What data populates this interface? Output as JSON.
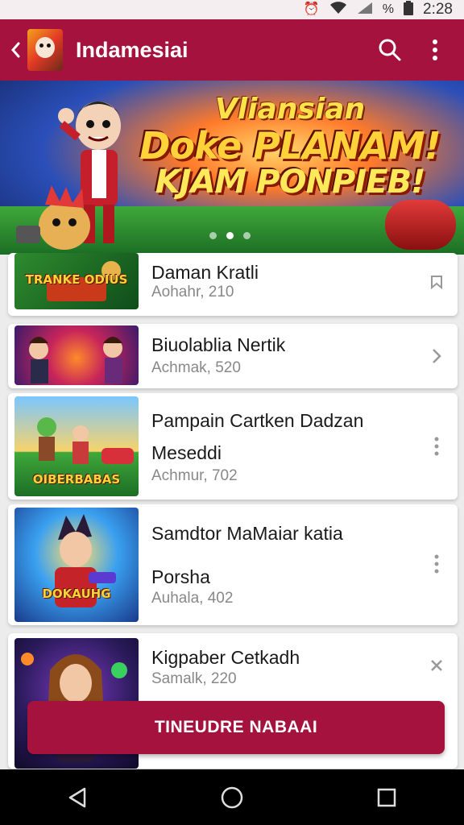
{
  "status_bar": {
    "time": "2:28",
    "icons": [
      "alarm-icon",
      "wifi-icon",
      "signal-icon",
      "battery-icon"
    ],
    "battery_label": "%"
  },
  "app_bar": {
    "title": "Indamesiai",
    "background": "#a5123e",
    "actions": [
      "back-icon",
      "search-icon",
      "more-vert-icon"
    ]
  },
  "banner": {
    "line1": "Vliansian",
    "line2": "Doke PLANAM!",
    "line3": "KJAM PONPIEB!",
    "page_count": 3,
    "active_page": 1
  },
  "games": [
    {
      "title": "Daman Kratli",
      "title2": "",
      "subtitle": "Aohahr, 210",
      "thumb_label": "TRANKE ODIUS",
      "action": "bookmark-icon"
    },
    {
      "title": "Biuolablia Nertik",
      "title2": "",
      "subtitle": "Achmak, 520",
      "thumb_label": "",
      "action": "chevron-right-icon"
    },
    {
      "title": "Pampain Cartken Dadzan",
      "title2": "Meseddi",
      "subtitle": "Achmur, 702",
      "thumb_label": "OIBERBABAS",
      "action": "more-vert-icon"
    },
    {
      "title": "Samdtor MaMaiar katia",
      "title2": "Porsha",
      "subtitle": "Auhala, 402",
      "thumb_label": "DOKAUHG",
      "action": "more-vert-icon"
    },
    {
      "title": "Kigpaber Cetkadh",
      "title2": "",
      "subtitle": "Samalk, 220",
      "thumb_label": "",
      "action": "close-icon"
    }
  ],
  "cta": {
    "label": "TINEUDRE NABAAI"
  },
  "nav": [
    "nav-back-icon",
    "nav-home-icon",
    "nav-recents-icon"
  ]
}
